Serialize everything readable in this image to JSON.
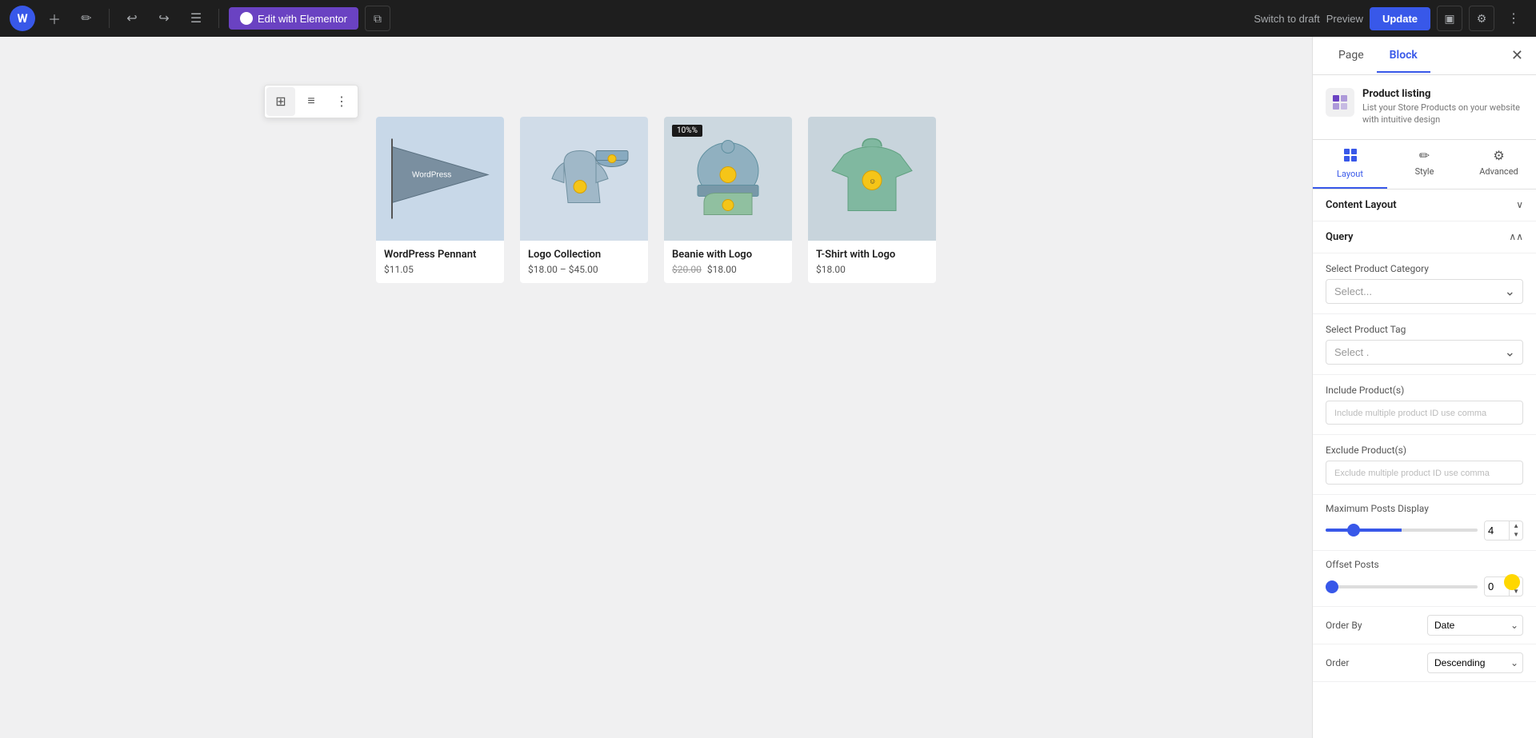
{
  "toolbar": {
    "wp_logo": "W",
    "add_label": "+",
    "tools_label": "✏",
    "undo_label": "↩",
    "redo_label": "↪",
    "list_view_label": "☰",
    "elementor_label": "Edit with Elementor",
    "copy_label": "⧉",
    "switch_draft_label": "Switch to draft",
    "preview_label": "Preview",
    "update_label": "Update",
    "view_toggle_label": "▣",
    "settings_label": "⚙",
    "more_label": "⋮"
  },
  "block_toolbar": {
    "grid_icon": "⊞",
    "list_icon": "≡",
    "more_icon": "⋮"
  },
  "products": [
    {
      "name": "WordPress Pennant",
      "price": "$11.05",
      "original_price": null,
      "badge": null,
      "color": "#c8d8e8"
    },
    {
      "name": "Logo Collection",
      "price": "$18.00 – $45.00",
      "original_price": null,
      "badge": null,
      "color": "#d0dce8"
    },
    {
      "name": "Beanie with Logo",
      "price": "$18.00",
      "original_price": "$20.00",
      "badge": "10%",
      "color": "#ccd8e0"
    },
    {
      "name": "T-Shirt with Logo",
      "price": "$18.00",
      "original_price": null,
      "badge": null,
      "color": "#c8d4dc"
    }
  ],
  "panel": {
    "page_tab": "Page",
    "block_tab": "Block",
    "close_icon": "✕",
    "block_info": {
      "title": "Product listing",
      "description": "List your Store Products on your website with intuitive design"
    },
    "sub_tabs": [
      {
        "icon": "▦",
        "label": "Layout"
      },
      {
        "icon": "✏",
        "label": "Style"
      },
      {
        "icon": "⚙",
        "label": "Advanced"
      }
    ],
    "sections": {
      "content_layout": "Content Layout",
      "query": "Query"
    },
    "fields": {
      "select_product_category_label": "Select Product Category",
      "select_product_category_placeholder": "Select...",
      "select_product_tag_label": "Select Product Tag",
      "select_product_tag_placeholder": "Select...",
      "include_products_label": "Include Product(s)",
      "include_products_placeholder": "Include multiple product ID use comma",
      "exclude_products_label": "Exclude Product(s)",
      "exclude_products_placeholder": "Exclude multiple product ID use comma",
      "max_posts_label": "Maximum Posts Display",
      "max_posts_value": "4",
      "offset_posts_label": "Offset Posts",
      "offset_posts_value": "0",
      "order_by_label": "Order By",
      "order_by_value": "Date",
      "order_label": "Order",
      "order_value": "Descending",
      "select_tag_placeholder": "Select ."
    }
  }
}
